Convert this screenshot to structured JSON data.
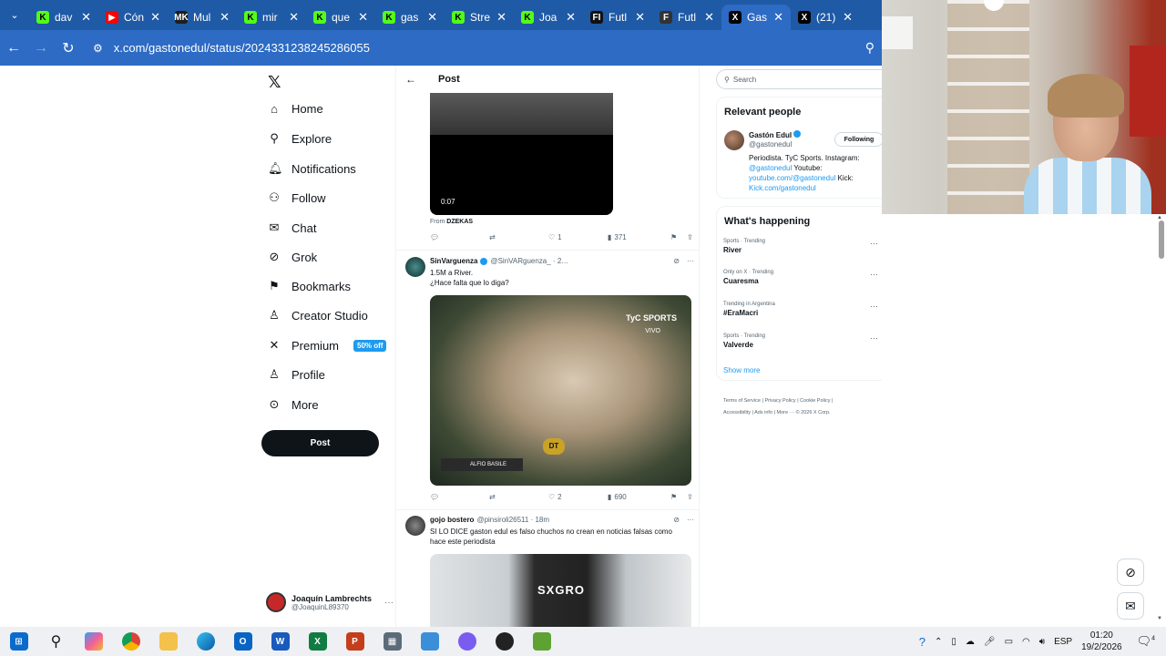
{
  "browser": {
    "tabs": [
      {
        "label": "dav",
        "fav_color": "#53fc18",
        "fav_text": "K"
      },
      {
        "label": "Cón",
        "fav_color": "#ff0000",
        "fav_text": "▶"
      },
      {
        "label": "Mul",
        "fav_color": "#1e1e1e",
        "fav_text": "MK"
      },
      {
        "label": "mir",
        "fav_color": "#53fc18",
        "fav_text": "K"
      },
      {
        "label": "que",
        "fav_color": "#53fc18",
        "fav_text": "K"
      },
      {
        "label": "gas",
        "fav_color": "#53fc18",
        "fav_text": "K"
      },
      {
        "label": "Stre",
        "fav_color": "#53fc18",
        "fav_text": "K"
      },
      {
        "label": "Joa",
        "fav_color": "#53fc18",
        "fav_text": "K"
      },
      {
        "label": "Futl",
        "fav_color": "#111111",
        "fav_text": "FI"
      },
      {
        "label": "Futl",
        "fav_color": "#333333",
        "fav_text": "F"
      },
      {
        "label": "Gas",
        "fav_color": "#000000",
        "fav_text": "X",
        "active": true
      },
      {
        "label": "(21)",
        "fav_color": "#000000",
        "fav_text": "X"
      }
    ],
    "url": "x.com/gastonedul/status/2024331238245286055"
  },
  "leftnav": {
    "items": [
      {
        "label": "Home",
        "icon": "home-icon",
        "glyph": "⌂"
      },
      {
        "label": "Explore",
        "icon": "search-icon",
        "glyph": "⚲"
      },
      {
        "label": "Notifications",
        "icon": "bell-icon",
        "glyph": "🔔︎"
      },
      {
        "label": "Follow",
        "icon": "person-add-icon",
        "glyph": "⚇"
      },
      {
        "label": "Chat",
        "icon": "mail-icon",
        "glyph": "✉"
      },
      {
        "label": "Grok",
        "icon": "grok-icon",
        "glyph": "⊘"
      },
      {
        "label": "Bookmarks",
        "icon": "bookmark-icon",
        "glyph": "⚑"
      },
      {
        "label": "Creator Studio",
        "icon": "creator-icon",
        "glyph": "♙"
      },
      {
        "label": "Premium",
        "icon": "x-icon",
        "glyph": "✕",
        "badge": "50% off"
      },
      {
        "label": "Profile",
        "icon": "profile-icon",
        "glyph": "♙"
      },
      {
        "label": "More",
        "icon": "more-circle-icon",
        "glyph": "⊙"
      }
    ],
    "post_button": "Post",
    "account": {
      "name": "Joaquín Lambrechts",
      "handle": "@JoaquinL89370"
    }
  },
  "main": {
    "header_title": "Post",
    "video1": {
      "time": "0:07",
      "from_label": "From",
      "from_source": "DZEKAS"
    },
    "actions1": {
      "likes": "1",
      "views": "371"
    },
    "tweet1": {
      "name": "SinVarguenza",
      "handle": "@SinVARguenza_ · 2…",
      "line1": "1.5M a River.",
      "line2": "¿Hace falta que lo diga?",
      "image_brand": "TyC SPORTS",
      "image_vivo": "VIVO",
      "image_lower": "ALFIO BASILE",
      "image_badge": "DT",
      "likes": "2",
      "views": "690"
    },
    "tweet2": {
      "name": "gojo bostero",
      "handle": "@pinsiroli26511 · 18m",
      "text": "SI LO DICE gaston edul es falso chuchos no crean en noticias falsas como hace este periodista",
      "image_brand": "SXGRO"
    }
  },
  "sidebar": {
    "search_placeholder": "Search",
    "relevant_title": "Relevant people",
    "person": {
      "name": "Gastón Edul",
      "handle": "@gastonedul",
      "button": "Following",
      "bio1": "Periodista. TyC Sports. Instagram:",
      "bio_link1": "@gastonedul",
      "bio2": " Youtube:",
      "bio_link2": "youtube.com/@gastonedul",
      "bio3": " Kick:",
      "bio_link3": "Kick.com/gastonedul"
    },
    "happening_title": "What's happening",
    "trends": [
      {
        "category": "Sports · Trending",
        "name": "River"
      },
      {
        "category": "Only on X · Trending",
        "name": "Cuaresma"
      },
      {
        "category": "Trending in Argentina",
        "name": "#EraMacri"
      },
      {
        "category": "Sports · Trending",
        "name": "Valverde"
      }
    ],
    "show_more": "Show more",
    "footer_line1": "Terms of Service  |  Privacy Policy  |  Cookie Policy  |",
    "footer_line2": "Accessibility  |  Ads info  |  More ···  © 2026 X Corp."
  },
  "taskbar": {
    "lang": "ESP",
    "time": "01:20",
    "date": "19/2/2026",
    "notif_count": "4"
  }
}
